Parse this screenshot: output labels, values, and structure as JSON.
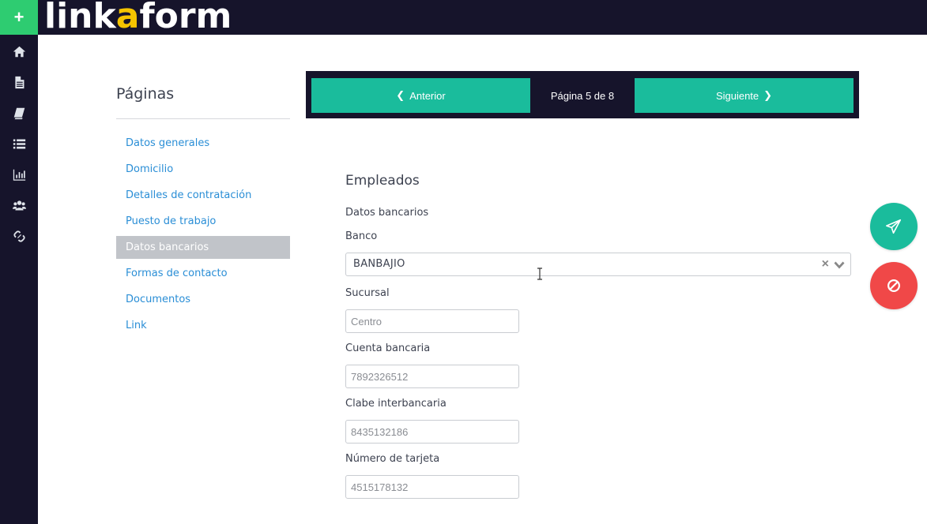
{
  "header": {
    "add_icon": "plus-icon",
    "logo_part1": "link",
    "logo_accent": "a",
    "logo_part2": "form",
    "colors": {
      "bar": "#16142b",
      "add": "#2ecc71",
      "accent": "#f5c400"
    }
  },
  "sidebar": {
    "icons": [
      "home-icon",
      "file-icon",
      "book-icon",
      "list-icon",
      "bar-chart-icon",
      "users-icon",
      "link-icon"
    ]
  },
  "pages": {
    "title": "Páginas",
    "items": [
      {
        "label": "Datos generales",
        "active": false
      },
      {
        "label": "Domicilio",
        "active": false
      },
      {
        "label": "Detalles de contratación",
        "active": false
      },
      {
        "label": "Puesto de trabajo",
        "active": false
      },
      {
        "label": "Datos bancarios",
        "active": true
      },
      {
        "label": "Formas de contacto",
        "active": false
      },
      {
        "label": "Documentos",
        "active": false
      },
      {
        "label": "Link",
        "active": false
      }
    ]
  },
  "pager": {
    "prev_label": "Anterior",
    "next_label": "Siguiente",
    "info": "Página 5 de 8",
    "colors": {
      "button": "#1abc9c",
      "bar": "#16142b"
    }
  },
  "form": {
    "title": "Empleados",
    "subtitle": "Datos bancarios",
    "banco_label": "Banco",
    "banco_value": "BANBAJIO",
    "sucursal_label": "Sucursal",
    "sucursal_value": "Centro",
    "cuenta_label": "Cuenta bancaria",
    "cuenta_value": "7892326512",
    "clabe_label": "Clabe interbancaria",
    "clabe_value": "8435132186",
    "tarjeta_label": "Número de tarjeta",
    "tarjeta_value": "4515178132"
  },
  "actions": {
    "send_icon": "paper-plane-icon",
    "cancel_icon": "ban-icon",
    "colors": {
      "send": "#1abc9c",
      "cancel": "#f04848"
    }
  }
}
